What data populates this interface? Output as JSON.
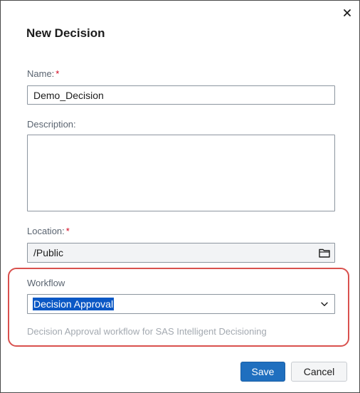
{
  "dialog": {
    "title": "New Decision",
    "close_glyph": "✕"
  },
  "form": {
    "name": {
      "label": "Name:",
      "required_mark": "*",
      "value": "Demo_Decision"
    },
    "description": {
      "label": "Description:",
      "value": ""
    },
    "location": {
      "label": "Location:",
      "required_mark": "*",
      "value": "/Public",
      "icon": "folder-icon"
    },
    "workflow": {
      "label": "Workflow",
      "selected": "Decision Approval",
      "icon": "chevron-down-icon",
      "hint": "Decision Approval workflow for SAS Intelligent Decisioning"
    }
  },
  "buttons": {
    "save": "Save",
    "cancel": "Cancel"
  },
  "colors": {
    "primary": "#1f6fbf",
    "required": "#d0021b",
    "selection": "#0b58c5",
    "highlight_outline": "#d9514e"
  }
}
